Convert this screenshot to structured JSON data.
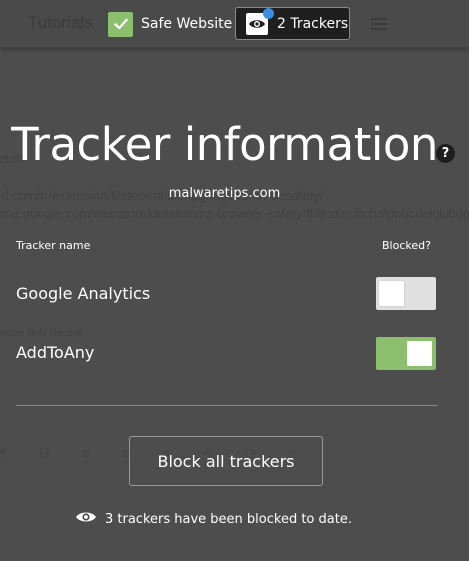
{
  "background_page": {
    "logo": "Tutorials",
    "lines": [
      "etrin",
      "ed.com/tr/extension/kleteoenkdienpgnngecdmn-desafety/",
      "ome.google.com/webstore/detail/avira-browser-safety/flliilndjeohchalpbbcdekjklbdgfkk",
      "Notes   illuhi   Recent"
    ],
    "toolbar_glyphs": "¶ H ≡ ≡ ≡ ↶ ↷ ⌂"
  },
  "header": {
    "safe_label": "Safe Website",
    "trackers_label": "2 Trackers"
  },
  "main": {
    "title": "Tracker information",
    "help_symbol": "?",
    "domain": "malwaretips.com",
    "col_tracker": "Tracker name",
    "col_blocked": "Blocked?",
    "trackers": [
      {
        "name": "Google Analytics",
        "blocked": false
      },
      {
        "name": "AddToAny",
        "blocked": true
      }
    ],
    "block_all_label": "Block all trackers",
    "footer_text": "3 trackers have been blocked to date."
  },
  "colors": {
    "overlay_bg": "#4d4d4d",
    "accent_green": "#8bbf6d",
    "toggle_off": "#e0e0e0",
    "notification_blue": "#3b8fe0"
  },
  "icons": {
    "safe_check": "check-icon",
    "trackers_eye": "eye-icon",
    "help": "help-icon",
    "footer_eye": "eye-icon"
  }
}
